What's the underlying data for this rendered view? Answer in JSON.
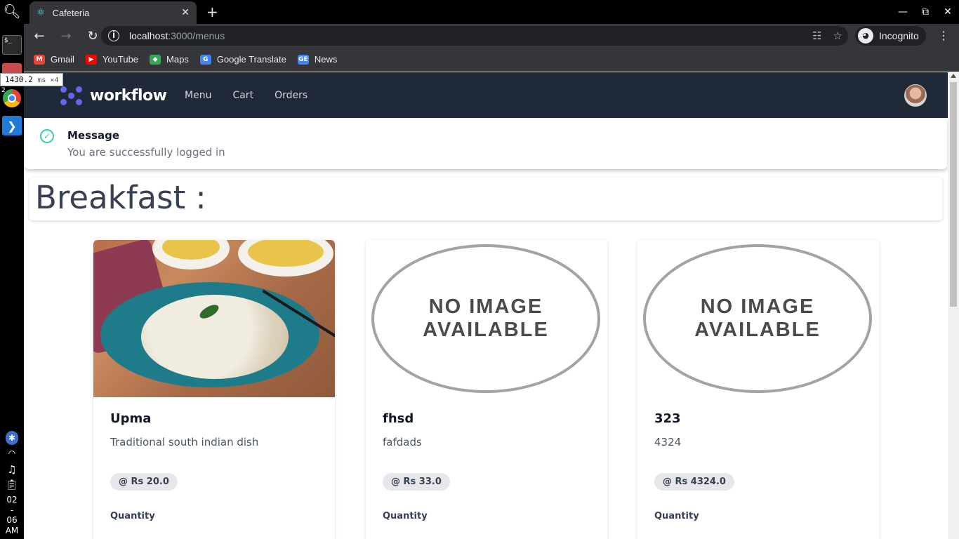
{
  "dock": {
    "badge": "2",
    "terminal_glyph": "$_",
    "clock": [
      "02",
      "-",
      "06",
      "AM"
    ]
  },
  "browser": {
    "tab_title": "Cafeteria",
    "url_host": "localhost",
    "url_path": ":3000/menus",
    "profile_label": "Incognito",
    "bookmarks": [
      {
        "label": "Gmail",
        "icon": "gmail-icon",
        "color": "#ea4335"
      },
      {
        "label": "YouTube",
        "icon": "youtube-icon",
        "color": "#ff0000"
      },
      {
        "label": "Maps",
        "icon": "maps-icon",
        "color": "#34a853"
      },
      {
        "label": "Google Translate",
        "icon": "translate-icon",
        "color": "#4285f4"
      },
      {
        "label": "News",
        "icon": "news-icon",
        "color": "#4285f4"
      }
    ]
  },
  "perf_overlay": {
    "value": "1430.2",
    "unit": "ms ×4"
  },
  "app": {
    "brand": "workflow",
    "brand_color": "#6366f1",
    "nav": [
      {
        "label": "Menu"
      },
      {
        "label": "Cart"
      },
      {
        "label": "Orders"
      }
    ]
  },
  "alert": {
    "title": "Message",
    "text": "You are successfully logged in",
    "color": "#34d399"
  },
  "section": {
    "title": "Breakfast :"
  },
  "no_image": {
    "line1": "NO IMAGE",
    "line2": "AVAILABLE"
  },
  "menu_items": [
    {
      "name": "Upma",
      "description": "Traditional south indian dish",
      "price": "@ Rs 20.0",
      "quantity_label": "Quantity",
      "image": "upma-photo"
    },
    {
      "name": "fhsd",
      "description": "fafdads",
      "price": "@ Rs 33.0",
      "quantity_label": "Quantity",
      "image": "no-image"
    },
    {
      "name": "323",
      "description": "4324",
      "price": "@ Rs 4324.0",
      "quantity_label": "Quantity",
      "image": "no-image"
    }
  ]
}
